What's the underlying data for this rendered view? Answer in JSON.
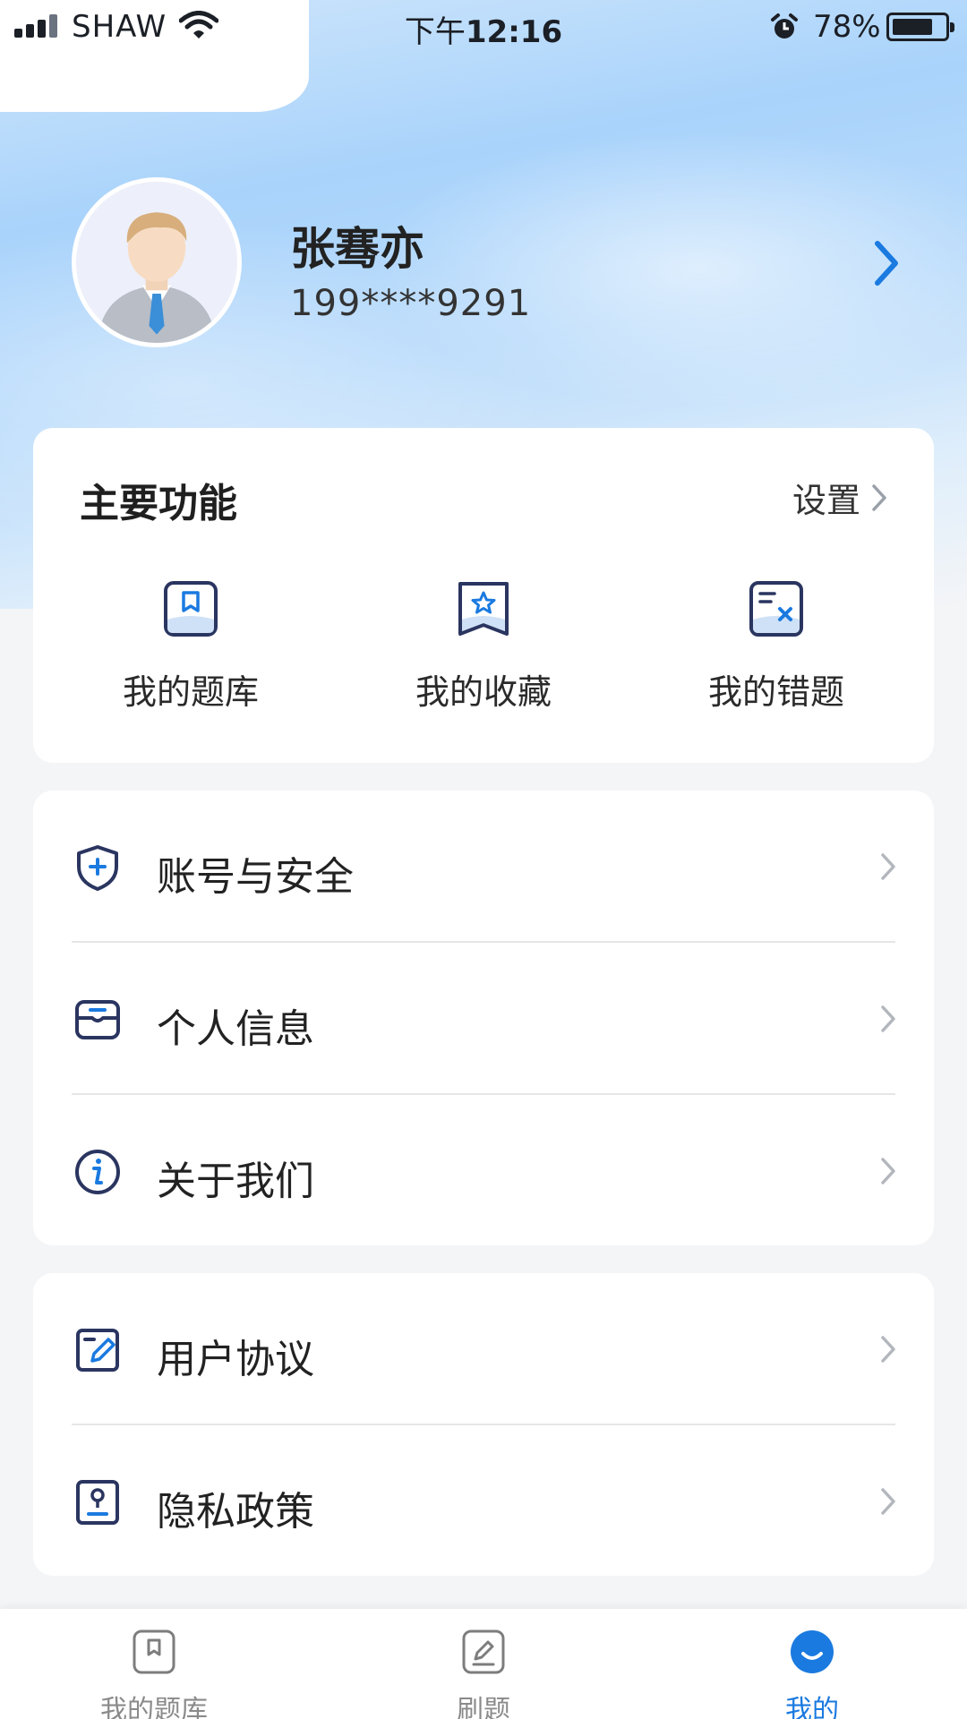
{
  "status_bar": {
    "carrier": "SHAW",
    "time_prefix": "下午",
    "time": "12:16",
    "battery": "78%",
    "battery_level": 0.78
  },
  "profile": {
    "name": "张骞亦",
    "phone": "199****9291"
  },
  "main_functions": {
    "title": "主要功能",
    "settings_label": "设置",
    "features": [
      {
        "label": "我的题库",
        "icon": "question-bank-icon"
      },
      {
        "label": "我的收藏",
        "icon": "favorites-icon"
      },
      {
        "label": "我的错题",
        "icon": "wrong-questions-icon"
      }
    ]
  },
  "menu_group_1": [
    {
      "label": "账号与安全",
      "icon": "shield-icon"
    },
    {
      "label": "个人信息",
      "icon": "personal-info-icon"
    },
    {
      "label": "关于我们",
      "icon": "info-icon"
    }
  ],
  "menu_group_2": [
    {
      "label": "用户协议",
      "icon": "agreement-icon"
    },
    {
      "label": "隐私政策",
      "icon": "privacy-icon"
    }
  ],
  "tab_bar": {
    "tabs": [
      {
        "label": "我的题库",
        "icon": "question-bank-icon",
        "active": false
      },
      {
        "label": "刷题",
        "icon": "practice-icon",
        "active": false
      },
      {
        "label": "我的",
        "icon": "profile-icon",
        "active": true
      }
    ]
  },
  "colors": {
    "accent": "#1a7ae0",
    "icon_navy": "#2a3560",
    "icon_blue": "#1a7ae0"
  }
}
